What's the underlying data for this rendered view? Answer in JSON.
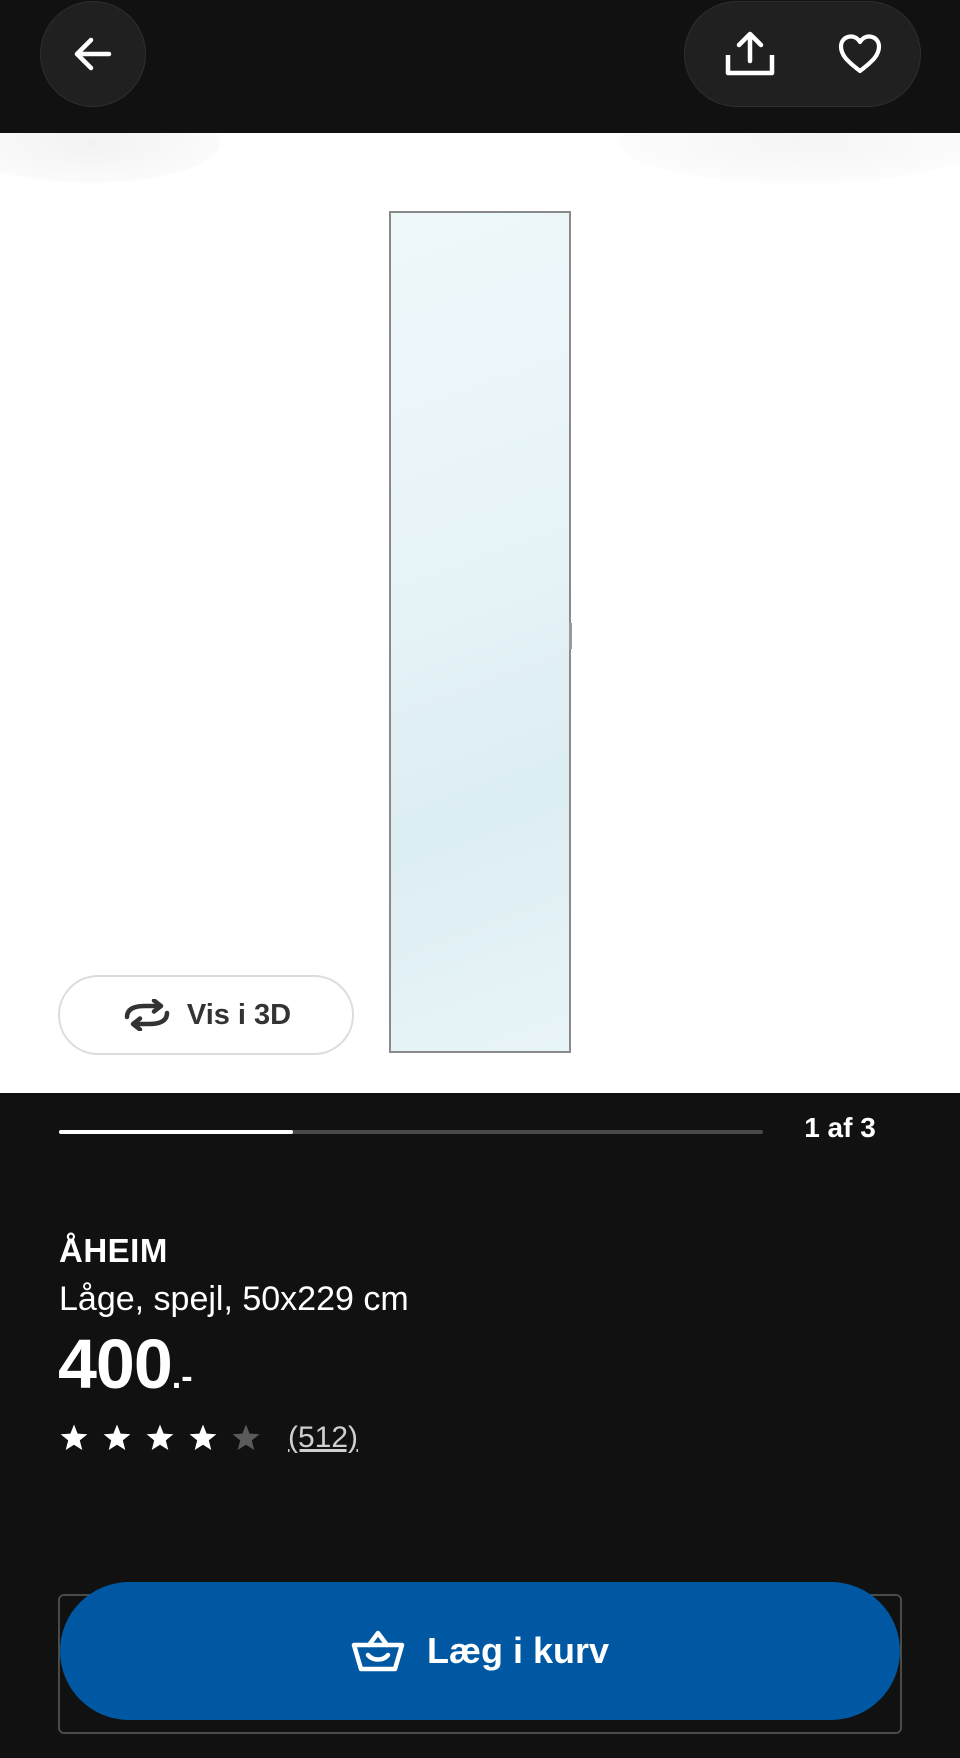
{
  "header": {
    "back_icon": "arrow-left-icon",
    "share_icon": "share-upload-icon",
    "favorite_icon": "heart-outline-icon"
  },
  "gallery": {
    "view3d_label": "Vis i 3D",
    "view3d_icon": "rotate-arrows-icon",
    "current_index": 1,
    "total_images": 3,
    "counter_text": "1 af 3",
    "progress_fraction": 0.333
  },
  "product": {
    "name": "ÅHEIM",
    "description": "Låge, spejl, 50x229 cm",
    "price_main": "400",
    "price_suffix": ".-",
    "rating_value": 4,
    "rating_max": 5,
    "review_count_text": "(512)"
  },
  "cart": {
    "label": "Læg i kurv",
    "icon": "basket-icon",
    "button_color": "#0058a3"
  },
  "colors": {
    "background": "#111111",
    "star_filled": "#ffffff",
    "star_empty": "#5a5a5a"
  }
}
